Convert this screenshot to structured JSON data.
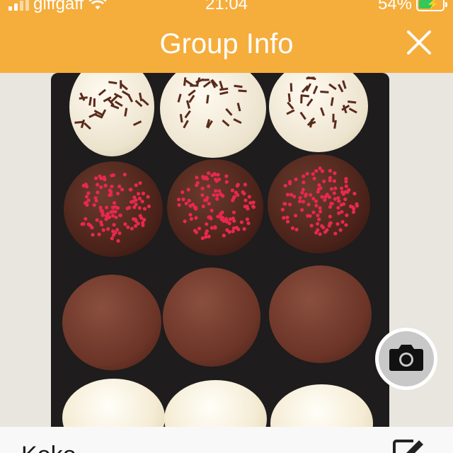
{
  "status_bar": {
    "carrier": "giffgaff",
    "time": "21:04",
    "battery_percent": "54%",
    "battery_level": 0.54,
    "charging": true,
    "signal_icon": "signal-icon",
    "wifi_icon": "wifi-icon",
    "battery_icon": "battery-charging-icon"
  },
  "header": {
    "title": "Group Info",
    "close_icon": "close-icon",
    "background_color": "#f5ad3c"
  },
  "photo": {
    "camera_icon": "camera-icon"
  },
  "group": {
    "name": "Koko",
    "edit_icon": "edit-icon"
  }
}
